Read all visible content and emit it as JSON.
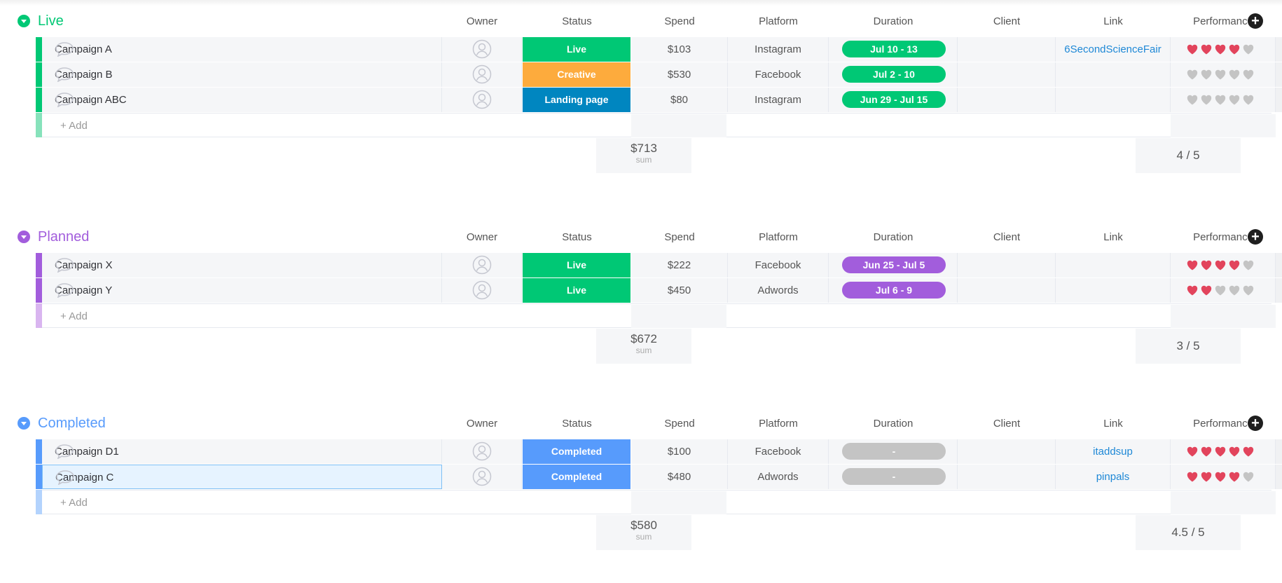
{
  "columns": {
    "owner": "Owner",
    "status": "Status",
    "spend": "Spend",
    "platform": "Platform",
    "duration": "Duration",
    "client": "Client",
    "link": "Link",
    "performance": "Performance"
  },
  "add_column_icon": "plus-circle-icon",
  "add_item_label": "+ Add",
  "sum_label": "sum",
  "colors": {
    "live": "#00c875",
    "planned": "#a25ddc",
    "completed": "#579bfc",
    "creative": "#fdab3d",
    "landing_page": "#0086c0",
    "grey_pill": "#c4c4c4",
    "heart_on": "#e2445c",
    "heart_off": "#c4c4c4"
  },
  "groups": [
    {
      "title": "Live",
      "color": "#00c875",
      "add_bar_color": "#87e2bb",
      "rows": [
        {
          "name": "Campaign A",
          "status": "Live",
          "status_color": "#00c875",
          "spend": "$103",
          "platform": "Instagram",
          "duration": "Jul 10 - 13",
          "duration_color": "#00c875",
          "client": "",
          "link": "6SecondScienceFair",
          "rating": 4
        },
        {
          "name": "Campaign B",
          "status": "Creative",
          "status_color": "#fdab3d",
          "spend": "$530",
          "platform": "Facebook",
          "duration": "Jul 2 - 10",
          "duration_color": "#00c875",
          "client": "",
          "link": "",
          "rating": 0
        },
        {
          "name": "Campaign ABC",
          "status": "Landing page",
          "status_color": "#0086c0",
          "spend": "$80",
          "platform": "Instagram",
          "duration": "Jun 29 - Jul 15",
          "duration_color": "#00c875",
          "client": "",
          "link": "",
          "rating": 0
        }
      ],
      "spend_sum": "$713",
      "performance_summary": "4 / 5"
    },
    {
      "title": "Planned",
      "color": "#a25ddc",
      "add_bar_color": "#d9b5f0",
      "rows": [
        {
          "name": "Campaign X",
          "status": "Live",
          "status_color": "#00c875",
          "spend": "$222",
          "platform": "Facebook",
          "duration": "Jun 25 - Jul 5",
          "duration_color": "#a25ddc",
          "client": "",
          "link": "",
          "rating": 4
        },
        {
          "name": "Campaign Y",
          "status": "Live",
          "status_color": "#00c875",
          "spend": "$450",
          "platform": "Adwords",
          "duration": "Jul 6 - 9",
          "duration_color": "#a25ddc",
          "client": "",
          "link": "",
          "rating": 2
        }
      ],
      "spend_sum": "$672",
      "performance_summary": "3 / 5"
    },
    {
      "title": "Completed",
      "color": "#579bfc",
      "add_bar_color": "#b3d3fd",
      "rows": [
        {
          "name": "Campaign D1",
          "status": "Completed",
          "status_color": "#579bfc",
          "spend": "$100",
          "platform": "Facebook",
          "duration": "-",
          "duration_color": "#c4c4c4",
          "client": "",
          "link": "itaddsup",
          "rating": 5
        },
        {
          "name": "Campaign C",
          "status": "Completed",
          "status_color": "#579bfc",
          "spend": "$480",
          "platform": "Adwords",
          "duration": "-",
          "duration_color": "#c4c4c4",
          "client": "",
          "link": "pinpals",
          "rating": 4,
          "selected": true
        }
      ],
      "spend_sum": "$580",
      "performance_summary": "4.5 / 5"
    }
  ]
}
